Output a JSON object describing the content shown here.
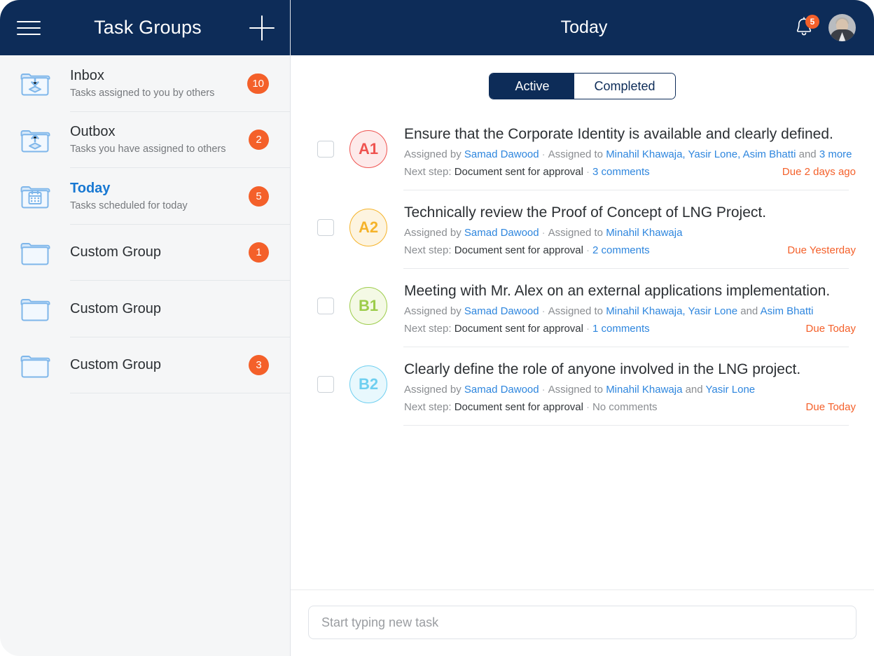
{
  "sidebar": {
    "header": {
      "title": "Task Groups",
      "menu_icon": "hamburger-menu-icon",
      "add_icon": "plus-icon"
    },
    "items": [
      {
        "label": "Inbox",
        "sub": "Tasks assigned to you by others",
        "count": "10",
        "icon": "folder-inbox-icon",
        "active": false
      },
      {
        "label": "Outbox",
        "sub": "Tasks you have assigned to others",
        "count": "2",
        "icon": "folder-outbox-icon",
        "active": false
      },
      {
        "label": "Today",
        "sub": "Tasks scheduled for today",
        "count": "5",
        "icon": "folder-calendar-icon",
        "active": true
      },
      {
        "label": "Custom Group",
        "sub": "",
        "count": "1",
        "icon": "folder-icon",
        "active": false
      },
      {
        "label": "Custom Group",
        "sub": "",
        "count": "",
        "icon": "folder-icon",
        "active": false
      },
      {
        "label": "Custom Group",
        "sub": "",
        "count": "3",
        "icon": "folder-icon",
        "active": false
      }
    ]
  },
  "header": {
    "title": "Today",
    "notification_icon": "bell-icon",
    "notification_count": "5",
    "avatar_icon": "user-avatar-icon"
  },
  "tabs": [
    {
      "label": "Active",
      "active": true
    },
    {
      "label": "Completed",
      "active": false
    }
  ],
  "tasks": [
    {
      "badge": "A1",
      "badge_color": "#ef5350",
      "badge_bg": "#fdeaea",
      "title": "Ensure that the Corporate Identity is available and clearly defined.",
      "assigned_by_label": "Assigned by",
      "assigned_by": "Samad Dawood",
      "assigned_to_label": "Assigned to",
      "assignees": "Minahil Khawaja, Yasir Lone, Asim Bhatti",
      "and_more_prefix": "and",
      "and_more": "3 more",
      "next_step_label": "Next step:",
      "next_step": "Document sent for approval",
      "comments": "3 comments",
      "comments_link": true,
      "due": "Due 2 days ago"
    },
    {
      "badge": "A2",
      "badge_color": "#f5b32a",
      "badge_bg": "#fdf4e0",
      "title": "Technically review the Proof of Concept of LNG Project.",
      "assigned_by_label": "Assigned by",
      "assigned_by": "Samad Dawood",
      "assigned_to_label": "Assigned to",
      "assignees": "Minahil Khawaja",
      "and_more_prefix": "",
      "and_more": "",
      "next_step_label": "Next step:",
      "next_step": "Document sent for approval",
      "comments": "2 comments",
      "comments_link": true,
      "due": "Due Yesterday"
    },
    {
      "badge": "B1",
      "badge_color": "#9ccc4a",
      "badge_bg": "#f4f9e5",
      "title": "Meeting with Mr. Alex on an external applications implementation.",
      "assigned_by_label": "Assigned by",
      "assigned_by": "Samad Dawood",
      "assigned_to_label": "Assigned to",
      "assignees": "Minahil Khawaja, Yasir Lone",
      "and_more_prefix": "and",
      "and_more": "Asim Bhatti",
      "next_step_label": "Next step:",
      "next_step": "Document sent for approval",
      "comments": "1 comments",
      "comments_link": true,
      "due": "Due Today"
    },
    {
      "badge": "B2",
      "badge_color": "#6ecff0",
      "badge_bg": "#e8f8fd",
      "title": "Clearly define the role of anyone involved in the LNG project.",
      "assigned_by_label": "Assigned by",
      "assigned_by": "Samad Dawood",
      "assigned_to_label": "Assigned to",
      "assignees": "Minahil Khawaja",
      "and_more_prefix": "and",
      "and_more": "Yasir Lone",
      "next_step_label": "Next step:",
      "next_step": "Document sent for approval",
      "comments": "No comments",
      "comments_link": false,
      "due": "Due Today"
    }
  ],
  "composer": {
    "placeholder": "Start typing new task"
  },
  "colors": {
    "navy": "#0d2c58",
    "orange": "#f4602a",
    "link_blue": "#2e86de",
    "active_blue": "#1878d2",
    "sidebar_bg": "#f5f6f7"
  }
}
